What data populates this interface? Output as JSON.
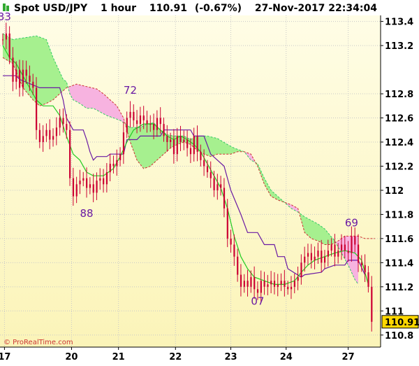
{
  "header": {
    "instrument": "Spot USD/JPY",
    "timeframe": "1 hour",
    "last": "110.91",
    "change": "(-0.67%)",
    "datetime": "27-Nov-2017 22:34:04"
  },
  "copyright": "© ProRealTime.com",
  "colors": {
    "bg_top": "#fffde6",
    "bg_bottom": "#fbf4b8",
    "candle": "#cc0033",
    "kijun": "#6a1aa3",
    "tenkan": "#22cc22",
    "cloud_bull": "#a6f08f",
    "cloud_bear": "#f7b3e0",
    "span_a": "#33cc66",
    "span_b": "#cc3333",
    "price_label_bg": "#ffd700",
    "text_dark": "#000000",
    "label_purple": "#6a1aa3",
    "icon_green": "#33aa33"
  },
  "chart_data": {
    "type": "candlestick",
    "indicator": "Ichimoku",
    "ylim": [
      110.7,
      113.45
    ],
    "x_range": [
      0,
      111
    ],
    "xticks": [
      {
        "x": 0.5,
        "label": "17"
      },
      {
        "x": 20.5,
        "label": "20"
      },
      {
        "x": 34.5,
        "label": "21"
      },
      {
        "x": 51.5,
        "label": "22"
      },
      {
        "x": 68,
        "label": "23"
      },
      {
        "x": 84.5,
        "label": "24"
      },
      {
        "x": 103,
        "label": "27"
      }
    ],
    "yticks": [
      110.8,
      111,
      111.2,
      111.4,
      111.6,
      111.8,
      112,
      112.2,
      112.4,
      112.6,
      112.8,
      113.2,
      113.4
    ],
    "price_label": "110.91",
    "annotations": [
      {
        "text": "33",
        "x": 0.5,
        "y": 113.41
      },
      {
        "text": "72",
        "x": 38,
        "y": 112.8
      },
      {
        "text": "88",
        "x": 25,
        "y": 111.78
      },
      {
        "text": "07",
        "x": 76,
        "y": 111.05
      },
      {
        "text": "69",
        "x": 104,
        "y": 111.7
      }
    ],
    "close_points": [
      [
        0,
        113.25
      ],
      [
        1,
        113.3
      ],
      [
        2,
        113.1
      ],
      [
        3,
        112.9
      ],
      [
        4,
        113.0
      ],
      [
        5,
        112.85
      ],
      [
        6,
        113.0
      ],
      [
        7,
        112.95
      ],
      [
        8,
        112.9
      ],
      [
        9,
        112.85
      ],
      [
        10,
        112.5
      ],
      [
        11,
        112.4
      ],
      [
        12,
        112.45
      ],
      [
        13,
        112.5
      ],
      [
        14,
        112.42
      ],
      [
        15,
        112.45
      ],
      [
        16,
        112.52
      ],
      [
        17,
        112.6
      ],
      [
        18,
        112.55
      ],
      [
        19,
        112.5
      ],
      [
        20,
        112.1
      ],
      [
        21,
        111.95
      ],
      [
        22,
        112.05
      ],
      [
        23,
        112.08
      ],
      [
        24,
        112.1
      ],
      [
        25,
        112.02
      ],
      [
        26,
        112.05
      ],
      [
        27,
        111.98
      ],
      [
        28,
        112.08
      ],
      [
        29,
        112.1
      ],
      [
        30,
        112.05
      ],
      [
        31,
        112.15
      ],
      [
        32,
        112.22
      ],
      [
        33,
        112.2
      ],
      [
        34,
        112.25
      ],
      [
        35,
        112.3
      ],
      [
        36,
        112.48
      ],
      [
        37,
        112.6
      ],
      [
        38,
        112.65
      ],
      [
        39,
        112.58
      ],
      [
        40,
        112.55
      ],
      [
        41,
        112.62
      ],
      [
        42,
        112.58
      ],
      [
        43,
        112.55
      ],
      [
        44,
        112.55
      ],
      [
        45,
        112.5
      ],
      [
        46,
        112.6
      ],
      [
        47,
        112.55
      ],
      [
        48,
        112.45
      ],
      [
        49,
        112.4
      ],
      [
        50,
        112.42
      ],
      [
        51,
        112.3
      ],
      [
        52,
        112.45
      ],
      [
        53,
        112.4
      ],
      [
        54,
        112.42
      ],
      [
        55,
        112.35
      ],
      [
        56,
        112.3
      ],
      [
        57,
        112.45
      ],
      [
        58,
        112.32
      ],
      [
        59,
        112.25
      ],
      [
        60,
        112.2
      ],
      [
        61,
        112.15
      ],
      [
        62,
        112.1
      ],
      [
        63,
        112.0
      ],
      [
        64,
        112.05
      ],
      [
        65,
        112.02
      ],
      [
        66,
        111.85
      ],
      [
        67,
        111.6
      ],
      [
        68,
        111.55
      ],
      [
        69,
        111.45
      ],
      [
        70,
        111.3
      ],
      [
        71,
        111.2
      ],
      [
        72,
        111.25
      ],
      [
        73,
        111.2
      ],
      [
        74,
        111.28
      ],
      [
        75,
        111.18
      ],
      [
        76,
        111.15
      ],
      [
        77,
        111.25
      ],
      [
        78,
        111.2
      ],
      [
        79,
        111.22
      ],
      [
        80,
        111.25
      ],
      [
        81,
        111.2
      ],
      [
        82,
        111.22
      ],
      [
        83,
        111.25
      ],
      [
        84,
        111.2
      ],
      [
        85,
        111.18
      ],
      [
        86,
        111.2
      ],
      [
        87,
        111.25
      ],
      [
        88,
        111.28
      ],
      [
        89,
        111.4
      ],
      [
        90,
        111.45
      ],
      [
        91,
        111.48
      ],
      [
        92,
        111.42
      ],
      [
        93,
        111.45
      ],
      [
        94,
        111.5
      ],
      [
        95,
        111.4
      ],
      [
        96,
        111.45
      ],
      [
        97,
        111.5
      ],
      [
        98,
        111.55
      ],
      [
        99,
        111.45
      ],
      [
        100,
        111.5
      ],
      [
        101,
        111.55
      ],
      [
        102,
        111.5
      ],
      [
        103,
        111.48
      ],
      [
        104,
        111.62
      ],
      [
        105,
        111.55
      ],
      [
        106,
        111.4
      ],
      [
        107,
        111.38
      ],
      [
        108,
        111.32
      ],
      [
        109,
        111.2
      ],
      [
        110,
        110.91
      ]
    ],
    "kijun_points": [
      [
        0,
        112.95
      ],
      [
        4,
        112.95
      ],
      [
        5,
        112.92
      ],
      [
        11,
        112.85
      ],
      [
        17,
        112.85
      ],
      [
        18,
        112.75
      ],
      [
        19,
        112.6
      ],
      [
        20,
        112.55
      ],
      [
        21,
        112.5
      ],
      [
        24,
        112.5
      ],
      [
        25,
        112.42
      ],
      [
        26,
        112.32
      ],
      [
        27,
        112.25
      ],
      [
        28,
        112.28
      ],
      [
        31,
        112.28
      ],
      [
        32,
        112.3
      ],
      [
        36,
        112.3
      ],
      [
        37,
        112.42
      ],
      [
        40,
        112.42
      ],
      [
        41,
        112.45
      ],
      [
        47,
        112.45
      ],
      [
        48,
        112.5
      ],
      [
        56,
        112.5
      ],
      [
        57,
        112.45
      ],
      [
        60,
        112.45
      ],
      [
        62,
        112.3
      ],
      [
        64,
        112.25
      ],
      [
        66,
        112.2
      ],
      [
        68,
        112.0
      ],
      [
        71,
        111.8
      ],
      [
        73,
        111.65
      ],
      [
        76,
        111.65
      ],
      [
        78,
        111.55
      ],
      [
        81,
        111.55
      ],
      [
        82,
        111.45
      ],
      [
        84,
        111.45
      ],
      [
        85,
        111.35
      ],
      [
        89,
        111.28
      ],
      [
        90,
        111.3
      ],
      [
        95,
        111.32
      ],
      [
        96,
        111.35
      ],
      [
        99,
        111.38
      ],
      [
        102,
        111.38
      ],
      [
        103,
        111.42
      ],
      [
        106,
        111.42
      ],
      [
        108,
        111.3
      ]
    ],
    "tenkan_points": [
      [
        0,
        113.2
      ],
      [
        2,
        113.1
      ],
      [
        4,
        113.05
      ],
      [
        6,
        112.95
      ],
      [
        8,
        112.85
      ],
      [
        10,
        112.75
      ],
      [
        12,
        112.7
      ],
      [
        15,
        112.7
      ],
      [
        17,
        112.62
      ],
      [
        19,
        112.45
      ],
      [
        21,
        112.3
      ],
      [
        23,
        112.25
      ],
      [
        25,
        112.15
      ],
      [
        27,
        112.12
      ],
      [
        30,
        112.12
      ],
      [
        33,
        112.18
      ],
      [
        35,
        112.28
      ],
      [
        37,
        112.4
      ],
      [
        39,
        112.5
      ],
      [
        42,
        112.55
      ],
      [
        45,
        112.55
      ],
      [
        47,
        112.5
      ],
      [
        49,
        112.45
      ],
      [
        51,
        112.42
      ],
      [
        53,
        112.45
      ],
      [
        55,
        112.42
      ],
      [
        57,
        112.38
      ],
      [
        59,
        112.32
      ],
      [
        61,
        112.22
      ],
      [
        63,
        112.12
      ],
      [
        65,
        112.02
      ],
      [
        67,
        111.85
      ],
      [
        69,
        111.62
      ],
      [
        71,
        111.45
      ],
      [
        73,
        111.35
      ],
      [
        75,
        111.28
      ],
      [
        78,
        111.25
      ],
      [
        81,
        111.22
      ],
      [
        84,
        111.22
      ],
      [
        87,
        111.25
      ],
      [
        89,
        111.32
      ],
      [
        91,
        111.38
      ],
      [
        93,
        111.42
      ],
      [
        96,
        111.45
      ],
      [
        99,
        111.48
      ],
      [
        102,
        111.5
      ],
      [
        105,
        111.48
      ],
      [
        107,
        111.42
      ],
      [
        109,
        111.22
      ]
    ],
    "span_a_points": [
      [
        0,
        113.3
      ],
      [
        3,
        113.25
      ],
      [
        10,
        113.28
      ],
      [
        13,
        113.25
      ],
      [
        15,
        113.1
      ],
      [
        17,
        112.98
      ],
      [
        18,
        112.92
      ],
      [
        19,
        112.9
      ],
      [
        20,
        112.8
      ],
      [
        21,
        112.75
      ],
      [
        23,
        112.72
      ],
      [
        25,
        112.68
      ],
      [
        27,
        112.68
      ],
      [
        29,
        112.65
      ],
      [
        31,
        112.62
      ],
      [
        33,
        112.6
      ],
      [
        35,
        112.58
      ],
      [
        38,
        112.52
      ],
      [
        41,
        112.52
      ],
      [
        43,
        112.55
      ],
      [
        45,
        112.56
      ],
      [
        47,
        112.5
      ],
      [
        49,
        112.46
      ],
      [
        51,
        112.45
      ],
      [
        54,
        112.45
      ],
      [
        56,
        112.42
      ],
      [
        58,
        112.45
      ],
      [
        61,
        112.45
      ],
      [
        64,
        112.43
      ],
      [
        67,
        112.38
      ],
      [
        69,
        112.35
      ],
      [
        72,
        112.32
      ],
      [
        74,
        112.25
      ],
      [
        76,
        112.22
      ],
      [
        78,
        112.1
      ],
      [
        80,
        112.0
      ],
      [
        82,
        111.95
      ],
      [
        84,
        111.9
      ],
      [
        86,
        111.85
      ],
      [
        88,
        111.82
      ],
      [
        90,
        111.78
      ],
      [
        92,
        111.75
      ],
      [
        94,
        111.72
      ],
      [
        96,
        111.68
      ],
      [
        99,
        111.58
      ],
      [
        101,
        111.48
      ],
      [
        103,
        111.38
      ],
      [
        105,
        111.26
      ],
      [
        106,
        111.22
      ]
    ],
    "span_b_points": [
      [
        0,
        113.1
      ],
      [
        3,
        113.05
      ],
      [
        6,
        112.85
      ],
      [
        9,
        112.75
      ],
      [
        11,
        112.7
      ],
      [
        13,
        112.72
      ],
      [
        15,
        112.75
      ],
      [
        17,
        112.8
      ],
      [
        19,
        112.85
      ],
      [
        22,
        112.88
      ],
      [
        25,
        112.86
      ],
      [
        28,
        112.84
      ],
      [
        30,
        112.8
      ],
      [
        32,
        112.75
      ],
      [
        34,
        112.7
      ],
      [
        36,
        112.6
      ],
      [
        38,
        112.4
      ],
      [
        40,
        112.25
      ],
      [
        42,
        112.18
      ],
      [
        44,
        112.2
      ],
      [
        46,
        112.25
      ],
      [
        48,
        112.3
      ],
      [
        50,
        112.35
      ],
      [
        52,
        112.38
      ],
      [
        54,
        112.4
      ],
      [
        56,
        112.38
      ],
      [
        58,
        112.33
      ],
      [
        60,
        112.3
      ],
      [
        62,
        112.28
      ],
      [
        64,
        112.3
      ],
      [
        66,
        112.3
      ],
      [
        68,
        112.3
      ],
      [
        70,
        112.32
      ],
      [
        72,
        112.32
      ],
      [
        74,
        112.3
      ],
      [
        76,
        112.2
      ],
      [
        78,
        112.05
      ],
      [
        80,
        111.95
      ],
      [
        82,
        111.92
      ],
      [
        84,
        111.9
      ],
      [
        86,
        111.88
      ],
      [
        88,
        111.85
      ],
      [
        90,
        111.65
      ],
      [
        92,
        111.6
      ],
      [
        94,
        111.58
      ],
      [
        96,
        111.55
      ],
      [
        98,
        111.55
      ],
      [
        100,
        111.58
      ],
      [
        102,
        111.62
      ],
      [
        104,
        111.62
      ],
      [
        106,
        111.62
      ],
      [
        108,
        111.6
      ],
      [
        111,
        111.6
      ]
    ]
  }
}
